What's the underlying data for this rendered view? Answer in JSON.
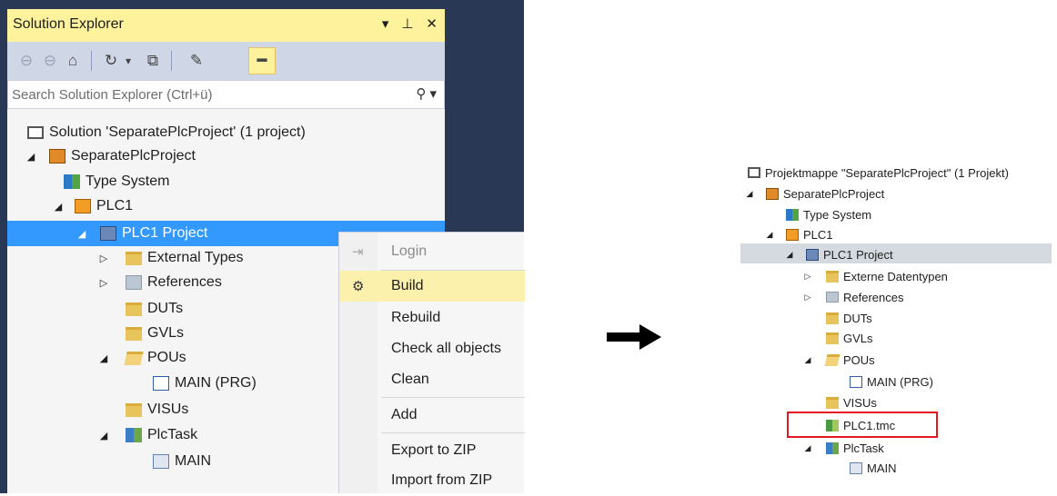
{
  "solution_explorer": {
    "title": "Solution Explorer",
    "title_controls": [
      "▾",
      "⊥",
      "✕"
    ],
    "search_placeholder": "Search Solution Explorer (Ctrl+ü)",
    "tree": [
      {
        "label": "Solution 'SeparatePlcProject' (1 project)",
        "icon": "solution-icon",
        "expander": ""
      },
      {
        "label": "SeparatePlcProject",
        "icon": "project-icon",
        "expander": "◢"
      },
      {
        "label": "Type System",
        "icon": "type-system-icon",
        "expander": ""
      },
      {
        "label": "PLC1",
        "icon": "plc-icon",
        "expander": "◢"
      },
      {
        "label": "PLC1 Project",
        "icon": "plc-project-icon",
        "expander": "◢",
        "selected": true
      },
      {
        "label": "External Types",
        "icon": "folder-icon",
        "expander": "▷"
      },
      {
        "label": "References",
        "icon": "references-icon",
        "expander": "▷"
      },
      {
        "label": "DUTs",
        "icon": "folder-icon",
        "expander": ""
      },
      {
        "label": "GVLs",
        "icon": "folder-icon",
        "expander": ""
      },
      {
        "label": "POUs",
        "icon": "folder-open-icon",
        "expander": "◢"
      },
      {
        "label": "MAIN (PRG)",
        "icon": "program-icon",
        "expander": ""
      },
      {
        "label": "VISUs",
        "icon": "folder-icon",
        "expander": ""
      },
      {
        "label": "PlcTask",
        "icon": "task-icon",
        "expander": "◢"
      },
      {
        "label": "MAIN",
        "icon": "task-reference-icon",
        "expander": ""
      }
    ]
  },
  "context_menu": {
    "items": [
      {
        "label": "Login",
        "icon": "login-icon",
        "disabled": true
      },
      {
        "label": "Build",
        "icon": "build-icon",
        "highlighted": true
      },
      {
        "label": "Rebuild"
      },
      {
        "label": "Check all objects"
      },
      {
        "label": "Clean"
      },
      {
        "label": "Add"
      },
      {
        "label": "Export to ZIP"
      },
      {
        "label": "Import from ZIP"
      }
    ]
  },
  "result_tree": {
    "tree": [
      {
        "label": "Projektmappe \"SeparatePlcProject\" (1 Projekt)",
        "icon": "solution-icon",
        "expander": ""
      },
      {
        "label": "SeparatePlcProject",
        "icon": "project-icon",
        "expander": "◢"
      },
      {
        "label": "Type System",
        "icon": "type-system-icon",
        "expander": ""
      },
      {
        "label": "PLC1",
        "icon": "plc-icon",
        "expander": "◢"
      },
      {
        "label": "PLC1 Project",
        "icon": "plc-project-icon",
        "expander": "◢",
        "selected": true
      },
      {
        "label": "Externe Datentypen",
        "icon": "folder-icon",
        "expander": "▷"
      },
      {
        "label": "References",
        "icon": "references-icon",
        "expander": "▷"
      },
      {
        "label": "DUTs",
        "icon": "folder-icon",
        "expander": ""
      },
      {
        "label": "GVLs",
        "icon": "folder-icon",
        "expander": ""
      },
      {
        "label": "POUs",
        "icon": "folder-open-icon",
        "expander": "◢"
      },
      {
        "label": "MAIN (PRG)",
        "icon": "program-icon",
        "expander": ""
      },
      {
        "label": "VISUs",
        "icon": "folder-icon",
        "expander": ""
      },
      {
        "label": "PLC1.tmc",
        "icon": "tmc-file-icon",
        "expander": "",
        "highlighted": true
      },
      {
        "label": "PlcTask",
        "icon": "task-icon",
        "expander": "◢"
      },
      {
        "label": "MAIN",
        "icon": "task-reference-icon",
        "expander": ""
      }
    ]
  },
  "colors": {
    "selection": "#3399ff",
    "active_title": "#fff29d",
    "menu_hover": "#fcf0ad",
    "highlight_box": "#e2171f"
  }
}
